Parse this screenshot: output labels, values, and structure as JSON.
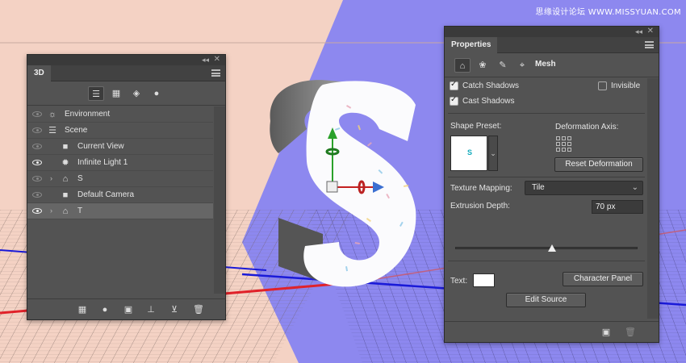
{
  "watermark": "思缘设计论坛 WWW.MISSYUAN.COM",
  "colors": {
    "panel_bg": "#535353",
    "bg_left": "#f4d2c4",
    "bg_right": "#8d88ef",
    "axis_red": "#e0222a",
    "axis_blue": "#1a1ad8"
  },
  "panel_3d": {
    "tab": "3D",
    "filters": [
      "scene-icon",
      "mesh-icon",
      "material-icon",
      "light-icon"
    ],
    "layers": [
      {
        "name": "Environment",
        "icon": "environment-icon",
        "visible": false,
        "indent": 0,
        "expandable": false,
        "selected": false
      },
      {
        "name": "Scene",
        "icon": "scene-icon",
        "visible": false,
        "indent": 0,
        "expandable": false,
        "selected": false
      },
      {
        "name": "Current View",
        "icon": "camera-icon",
        "visible": false,
        "indent": 1,
        "expandable": false,
        "selected": false
      },
      {
        "name": "Infinite Light 1",
        "icon": "light-icon",
        "visible": true,
        "indent": 1,
        "expandable": false,
        "selected": false
      },
      {
        "name": "S",
        "icon": "mesh-icon",
        "visible": false,
        "indent": 1,
        "expandable": true,
        "selected": false
      },
      {
        "name": "Default Camera",
        "icon": "camera-icon",
        "visible": false,
        "indent": 1,
        "expandable": false,
        "selected": false
      },
      {
        "name": "T",
        "icon": "mesh-icon",
        "visible": true,
        "indent": 1,
        "expandable": true,
        "selected": true
      }
    ],
    "bottom_buttons": [
      "new-mesh-icon",
      "new-light-icon",
      "render-icon",
      "drop-to-ground-icon",
      "split-mesh-icon",
      "trash-icon"
    ]
  },
  "properties": {
    "tab": "Properties",
    "icon_tabs": [
      "mesh-tab-icon",
      "deform-tab-icon",
      "cap-tab-icon",
      "coordinates-tab-icon"
    ],
    "section": "Mesh",
    "catch_shadows": {
      "label": "Catch Shadows",
      "checked": true
    },
    "invisible": {
      "label": "Invisible",
      "checked": false
    },
    "cast_shadows": {
      "label": "Cast Shadows",
      "checked": true
    },
    "shape_preset_label": "Shape Preset:",
    "deformation_axis_label": "Deformation Axis:",
    "reset_deformation": "Reset Deformation",
    "texture_mapping_label": "Texture Mapping:",
    "texture_mapping_value": "Tile",
    "extrusion_depth_label": "Extrusion Depth:",
    "extrusion_depth_value": "70 px",
    "extrusion_slider_level": 0.53,
    "text_label": "Text:",
    "character_panel": "Character Panel",
    "edit_source": "Edit Source",
    "bottom_buttons": [
      "render-icon",
      "trash-icon"
    ]
  }
}
